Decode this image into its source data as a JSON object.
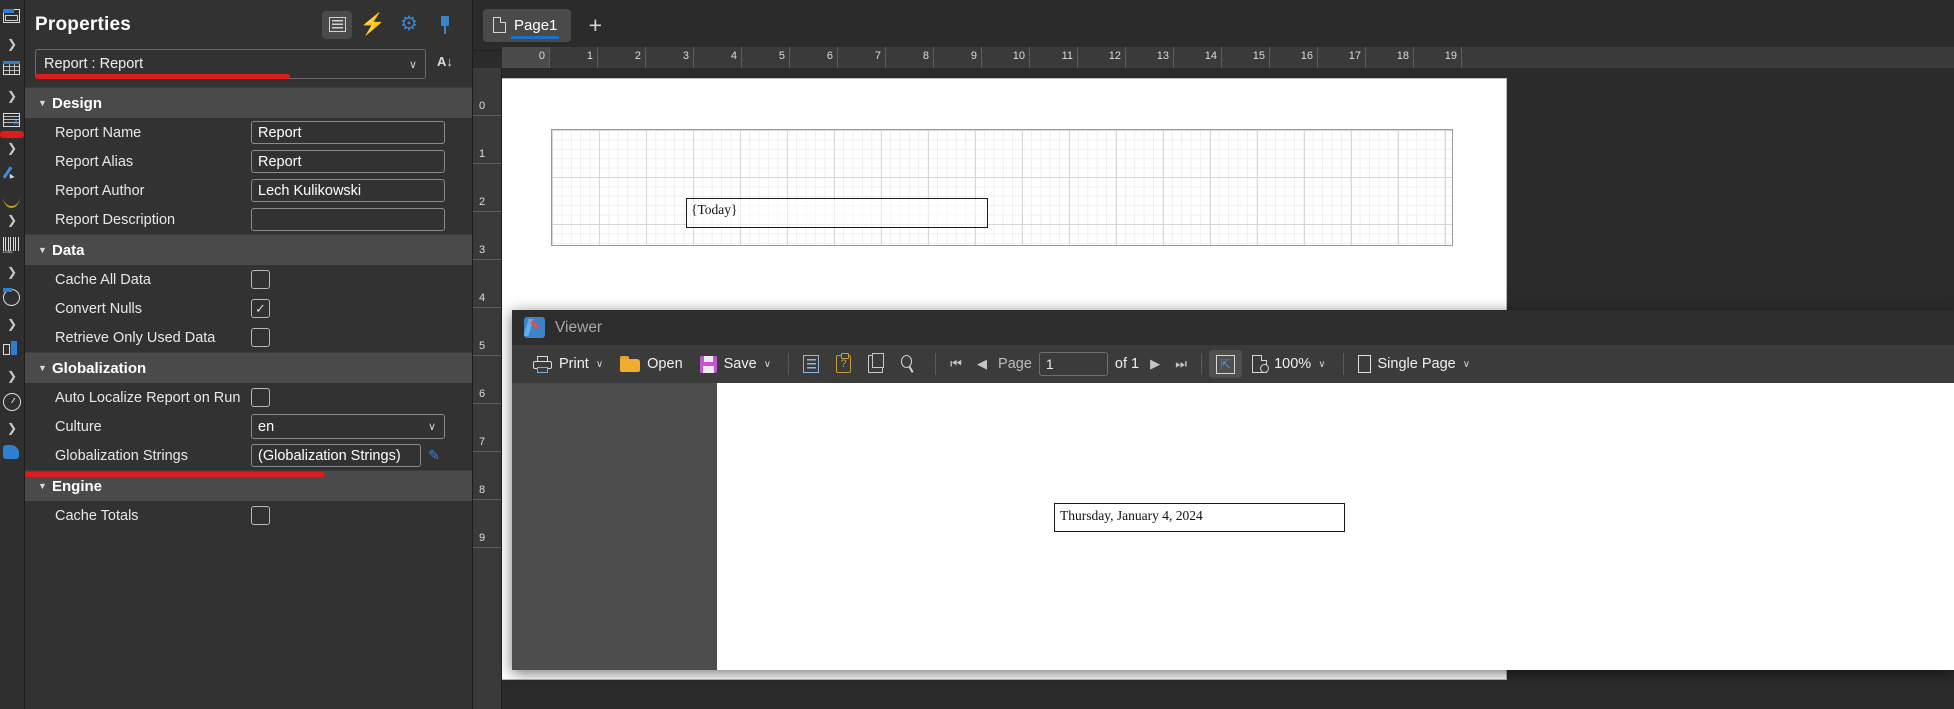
{
  "toolbox": {
    "items": [
      {
        "name": "panel-component",
        "icon": "panel-icon"
      },
      {
        "name": "table-component",
        "icon": "table-icon"
      },
      {
        "name": "rich-text-component",
        "icon": "rich-text-icon"
      },
      {
        "name": "shape-component",
        "icon": "pencil-icon"
      },
      {
        "name": "barcode-component",
        "icon": "barcode-icon"
      },
      {
        "name": "ellipse-component",
        "icon": "circle-icon"
      },
      {
        "name": "chart-component",
        "icon": "chart-icon"
      },
      {
        "name": "gauge-component",
        "icon": "gauge-icon"
      }
    ]
  },
  "properties": {
    "title": "Properties",
    "header_buttons": [
      {
        "name": "categorized-view-button",
        "icon": "list-icon",
        "active": true
      },
      {
        "name": "events-button",
        "icon": "lightning-icon",
        "active": false
      },
      {
        "name": "settings-button",
        "icon": "gear-icon",
        "active": false
      },
      {
        "name": "pin-button",
        "icon": "pin-icon",
        "active": false
      }
    ],
    "object_selector": {
      "value": "Report : Report",
      "caret": "∨"
    },
    "sort_button": {
      "name": "sort-alphabetically-button",
      "label": "A↓"
    },
    "sections": [
      {
        "title": "Design",
        "expanded": true,
        "rows": [
          {
            "label": "Report Name",
            "type": "text",
            "value": "Report"
          },
          {
            "label": "Report Alias",
            "type": "text",
            "value": "Report"
          },
          {
            "label": "Report Author",
            "type": "text",
            "value": "Lech Kulikowski"
          },
          {
            "label": "Report Description",
            "type": "text",
            "value": ""
          }
        ]
      },
      {
        "title": "Data",
        "expanded": true,
        "rows": [
          {
            "label": "Cache All Data",
            "type": "checkbox",
            "checked": false
          },
          {
            "label": "Convert Nulls",
            "type": "checkbox",
            "checked": true
          },
          {
            "label": "Retrieve Only Used Data",
            "type": "checkbox",
            "checked": false
          }
        ]
      },
      {
        "title": "Globalization",
        "expanded": true,
        "rows": [
          {
            "label": "Auto Localize Report on Run",
            "type": "checkbox",
            "checked": false
          },
          {
            "label": "Culture",
            "type": "select",
            "value": "en"
          },
          {
            "label": "Globalization Strings",
            "type": "text-button",
            "value": "(Globalization Strings)",
            "button_icon": "edit-pencil-icon"
          }
        ]
      },
      {
        "title": "Engine",
        "expanded": true,
        "rows": [
          {
            "label": "Cache Totals",
            "type": "checkbox",
            "checked": false
          }
        ]
      }
    ],
    "checkmark": "✓"
  },
  "designer": {
    "tabs": [
      {
        "label": "Page1",
        "icon": "page-icon",
        "active": true
      }
    ],
    "add_tab_label": "+",
    "h_ruler": [
      "0",
      "1",
      "2",
      "3",
      "4",
      "5",
      "6",
      "7",
      "8",
      "9",
      "10",
      "11",
      "12",
      "13",
      "14",
      "15",
      "16",
      "17",
      "18",
      "19"
    ],
    "v_ruler": [
      "0",
      "1",
      "2",
      "3",
      "4",
      "5",
      "6",
      "7",
      "8",
      "9"
    ],
    "textbox_value": "{Today}"
  },
  "viewer": {
    "title": "Viewer",
    "toolbar": {
      "print_label": "Print",
      "open_label": "Open",
      "save_label": "Save",
      "chevron": "∨",
      "page_label": "Page",
      "page_value": "1",
      "of_label": "of 1",
      "zoom_value": "100%",
      "view_mode": "Single Page",
      "buttons": [
        {
          "name": "print-button",
          "icon": "printer-icon"
        },
        {
          "name": "open-button",
          "icon": "folder-icon"
        },
        {
          "name": "save-button",
          "icon": "floppy-disk-icon"
        },
        {
          "name": "bookmarks-button",
          "icon": "document-list-icon"
        },
        {
          "name": "parameters-button",
          "icon": "clipboard-question-icon"
        },
        {
          "name": "page-setup-button",
          "icon": "pages-icon"
        },
        {
          "name": "find-button",
          "icon": "magnifier-icon"
        },
        {
          "name": "first-page-button",
          "icon": "first-page-icon"
        },
        {
          "name": "prev-page-button",
          "icon": "previous-page-icon"
        },
        {
          "name": "next-page-button",
          "icon": "next-page-icon"
        },
        {
          "name": "last-page-button",
          "icon": "last-page-icon"
        },
        {
          "name": "fit-page-button",
          "icon": "fit-page-icon"
        },
        {
          "name": "zoom-button",
          "icon": "zoom-document-icon"
        },
        {
          "name": "view-mode-button",
          "icon": "single-page-icon"
        }
      ]
    },
    "rendered_text": "Thursday, January 4, 2024"
  }
}
